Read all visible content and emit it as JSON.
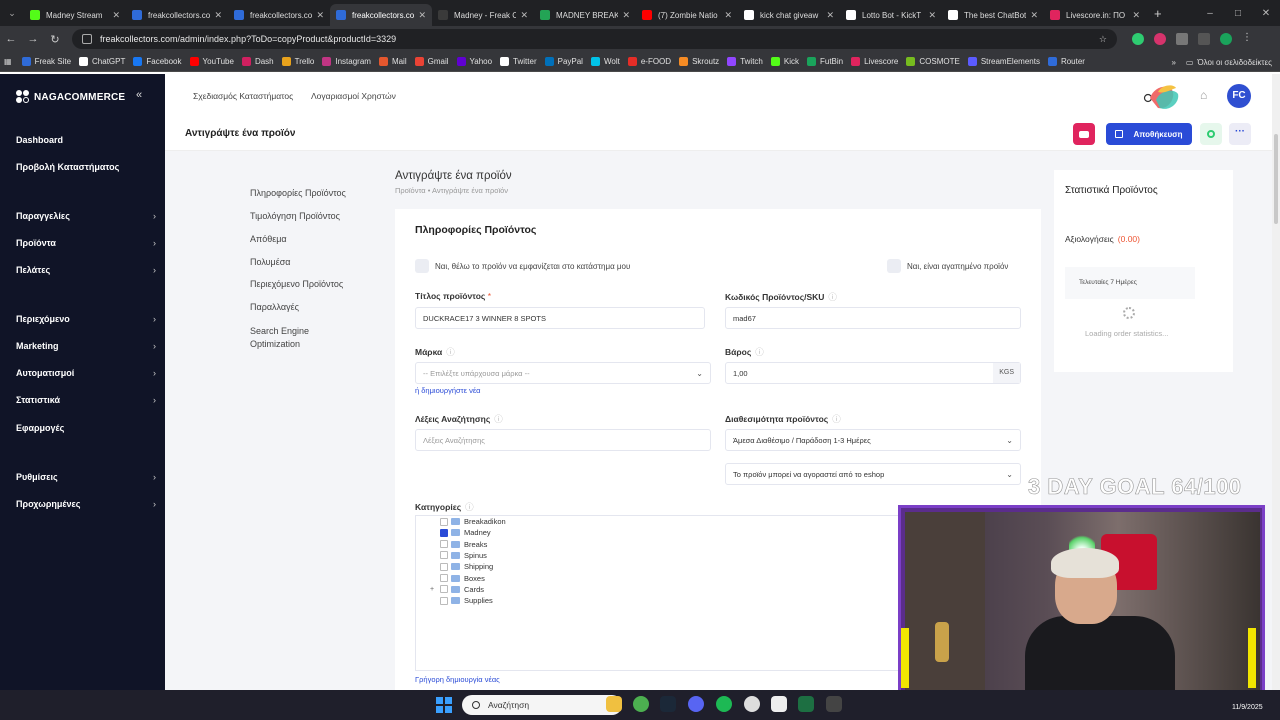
{
  "browser": {
    "tabs": [
      {
        "label": "Madney Stream",
        "favicon_color": "#53fc18",
        "active": false
      },
      {
        "label": "freakcollectors.co",
        "favicon_color": "#2f6bd8",
        "active": false
      },
      {
        "label": "freakcollectors.co",
        "favicon_color": "#2f6bd8",
        "active": false
      },
      {
        "label": "freakcollectors.co",
        "favicon_color": "#2f6bd8",
        "active": true
      },
      {
        "label": "Madney - Freak C",
        "favicon_color": "#3a3a3a",
        "active": false
      },
      {
        "label": "MADNEY BREAKS",
        "favicon_color": "#23a455",
        "active": false
      },
      {
        "label": "(7) Zombie Natio",
        "favicon_color": "#ff0000",
        "active": false
      },
      {
        "label": "kick chat giveaw",
        "favicon_color": "#ffffff",
        "active": false
      },
      {
        "label": "Lotto Bot - KickT",
        "favicon_color": "#ffffff",
        "active": false
      },
      {
        "label": "The best ChatBot",
        "favicon_color": "#ffffff",
        "active": false
      },
      {
        "label": "Livescore.in: ΠΟ",
        "favicon_color": "#e0245e",
        "active": false
      }
    ],
    "new_tab": "+",
    "url": "freakcollectors.com/admin/index.php?ToDo=copyProduct&productId=3329",
    "bookmarks": [
      {
        "label": "Freak Site",
        "color": "#2f6bd8"
      },
      {
        "label": "ChatGPT",
        "color": "#ffffff"
      },
      {
        "label": "Facebook",
        "color": "#1877f2"
      },
      {
        "label": "YouTube",
        "color": "#ff0000"
      },
      {
        "label": "Dash",
        "color": "#d02060"
      },
      {
        "label": "Trello",
        "color": "#e8a21c"
      },
      {
        "label": "Instagram",
        "color": "#c13584"
      },
      {
        "label": "Mail",
        "color": "#e4572e"
      },
      {
        "label": "Gmail",
        "color": "#ea4335"
      },
      {
        "label": "Yahoo",
        "color": "#6001d2"
      },
      {
        "label": "Twitter",
        "color": "#ffffff"
      },
      {
        "label": "PayPal",
        "color": "#0070ba"
      },
      {
        "label": "Wolt",
        "color": "#00c2e8"
      },
      {
        "label": "e-FOOD",
        "color": "#e52d27"
      },
      {
        "label": "Skroutz",
        "color": "#f68b24"
      },
      {
        "label": "Twitch",
        "color": "#9146ff"
      },
      {
        "label": "Kick",
        "color": "#53fc18"
      },
      {
        "label": "FutBin",
        "color": "#1aa35b"
      },
      {
        "label": "Livescore",
        "color": "#e0245e"
      },
      {
        "label": "COSMOTE",
        "color": "#77bc1f"
      },
      {
        "label": "StreamElements",
        "color": "#5b5bff"
      },
      {
        "label": "Router",
        "color": "#2f6bd8"
      }
    ],
    "all_bookmarks": "Όλοι οι σελιδοδείκτες"
  },
  "sidebar": {
    "brand": "NAGACOMMERCE",
    "items": [
      {
        "label": "Dashboard",
        "chevron": ""
      },
      {
        "label": "Προβολή Καταστήματος",
        "chevron": ""
      },
      {
        "label": "Παραγγελίες",
        "chevron": "›"
      },
      {
        "label": "Προϊόντα",
        "chevron": "›"
      },
      {
        "label": "Πελάτες",
        "chevron": "›"
      },
      {
        "label": "Περιεχόμενο",
        "chevron": "›"
      },
      {
        "label": "Marketing",
        "chevron": "›"
      },
      {
        "label": "Αυτοματισμοί",
        "chevron": "›"
      },
      {
        "label": "Στατιστικά",
        "chevron": "›"
      },
      {
        "label": "Εφαρμογές",
        "chevron": ""
      },
      {
        "label": "Ρυθμίσεις",
        "chevron": "›"
      },
      {
        "label": "Προχωρημένες",
        "chevron": "›"
      }
    ]
  },
  "topbar": {
    "links": [
      "Σχεδιασμός Καταστήματος",
      "Λογαριασμοί Χρηστών"
    ],
    "avatar_initials": "FC"
  },
  "pagehead": {
    "title": "Αντιγράψτε ένα προϊόν",
    "save_label": "Αποθήκευση"
  },
  "section_nav": [
    "Πληροφορίες Προϊόντος",
    "Τιμολόγηση Προϊόντος",
    "Απόθεμα",
    "Πολυμέσα",
    "Περιεχόμενο Προϊόντος",
    "Παραλλαγές",
    "Search Engine",
    "Optimization"
  ],
  "main": {
    "title": "Αντιγράψτε ένα προϊόν",
    "breadcrumb": "Προϊόντα  •  Αντιγράψτε ένα προϊόν",
    "card_title": "Πληροφορίες Προϊόντος",
    "visible_check": "Ναι, θέλω το προϊόν να εμφανίζεται στο κατάστημα μου",
    "favorite_check": "Ναι, είναι αγαπημένο προϊόν",
    "title_label": "Τίτλος προϊόντος",
    "title_req": "*",
    "title_value": "DUCKRACE17 3 WINNER 8 SPOTS",
    "sku_label": "Κωδικός Προϊόντος/SKU",
    "sku_value": "mad67",
    "brand_label": "Μάρκα",
    "brand_placeholder": "-- Επιλέξτε υπάρχουσα μάρκα --",
    "brand_create": "ή δημιουργήστε νέα",
    "weight_label": "Βάρος",
    "weight_value": "1,00",
    "weight_unit": "KGS",
    "keywords_label": "Λέξεις Αναζήτησης",
    "keywords_placeholder": "Λέξεις Αναζήτησης",
    "availability_label": "Διαθεσιμότητα προϊόντος",
    "availability_value": "Άμεσα Διαθέσιμο / Παράδοση 1-3 Ημέρες",
    "purchase_value": "Το προϊόν μπορεί να αγοραστεί από το eshop",
    "categories_label": "Κατηγορίες",
    "categories": [
      {
        "label": "Breakadikon",
        "checked": false,
        "expand": ""
      },
      {
        "label": "Madney",
        "checked": true,
        "expand": ""
      },
      {
        "label": "Breaks",
        "checked": false,
        "expand": ""
      },
      {
        "label": "Spinus",
        "checked": false,
        "expand": ""
      },
      {
        "label": "Shipping",
        "checked": false,
        "expand": ""
      },
      {
        "label": "Boxes",
        "checked": false,
        "expand": ""
      },
      {
        "label": "Cards",
        "checked": false,
        "expand": "+"
      },
      {
        "label": "Supplies",
        "checked": false,
        "expand": ""
      }
    ],
    "quick_create": "Γρήγορη δημιουργία νέας"
  },
  "stats": {
    "title": "Στατιστικά Προϊόντος",
    "rating_label": "Αξιολογήσεις",
    "rating_value": "(0.00)",
    "period": "Τελευταίες 7 Ημέρες",
    "loading": "Loading order statistics..."
  },
  "overlay": {
    "goal": "3 DAY GOAL 64/100"
  },
  "taskbar": {
    "search": "Αναζήτηση",
    "date": "11/9/2025"
  },
  "colors": {
    "sidebar_bg": "#101427",
    "accent": "#2a4bd7",
    "youtube_button": "#e0245e",
    "content_bg": "#f4f5f8",
    "required": "#e53"
  }
}
